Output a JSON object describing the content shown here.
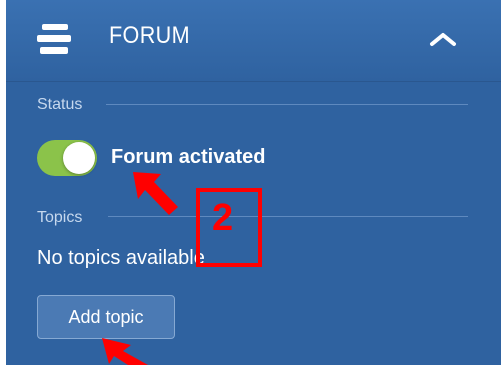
{
  "header": {
    "title": "FORUM",
    "icon": "stack-icon",
    "collapse_icon": "chevron-up-icon"
  },
  "status": {
    "label": "Status",
    "toggle": {
      "state": "on",
      "label": "Forum activated"
    }
  },
  "topics": {
    "label": "Topics",
    "empty_text": "No topics available",
    "add_button_label": "Add topic"
  },
  "annotation": {
    "number": "2"
  },
  "colors": {
    "panel": "#2f62a0",
    "toggle_on": "#8bc34a",
    "annotation": "#ff0000"
  }
}
